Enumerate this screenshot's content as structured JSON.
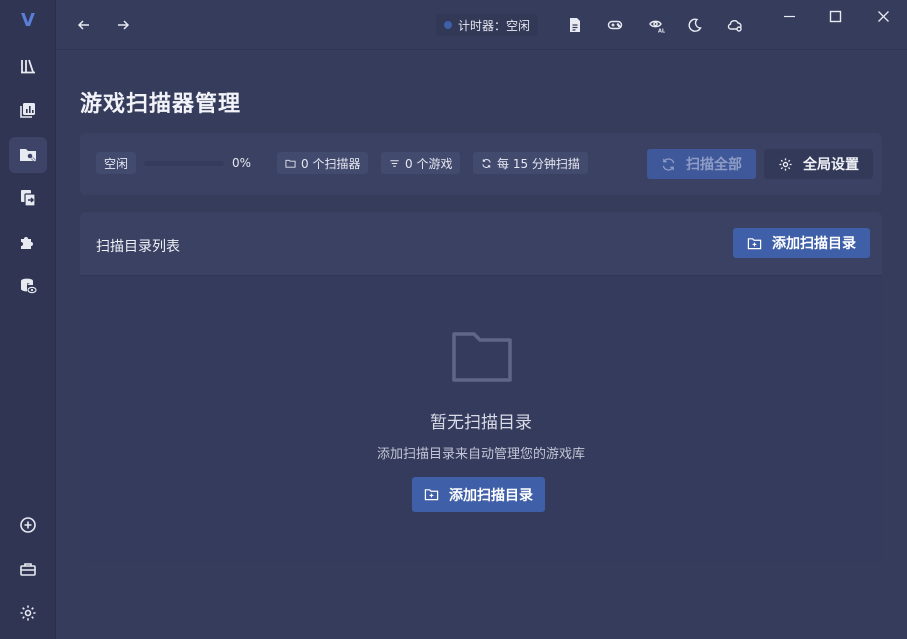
{
  "app": {
    "logo": "V"
  },
  "sidebar": {
    "items": [
      {
        "icon": "library-icon"
      },
      {
        "icon": "stats-icon"
      },
      {
        "icon": "folder-search-icon",
        "active": true
      },
      {
        "icon": "import-icon"
      },
      {
        "icon": "plugin-icon"
      },
      {
        "icon": "database-view-icon"
      }
    ],
    "bottom": [
      {
        "icon": "add-circle-icon"
      },
      {
        "icon": "toolbox-icon"
      },
      {
        "icon": "settings-icon"
      }
    ]
  },
  "titlebar": {
    "timer_label": "计时器：空闲",
    "actions": [
      "document-icon",
      "gamepad-icon",
      "eye-all-icon",
      "moon-icon",
      "cloud-icon"
    ]
  },
  "page": {
    "title": "游戏扫描器管理"
  },
  "toolbar": {
    "status": "空闲",
    "progress_percent": 0,
    "progress_label": "0%",
    "scanners": "0 个扫描器",
    "games": "0 个游戏",
    "interval": "每 15 分钟扫描",
    "scan_all": "扫描全部",
    "global_settings": "全局设置"
  },
  "panel": {
    "title": "扫描目录列表",
    "add_button": "添加扫描目录",
    "empty_title": "暂无扫描目录",
    "empty_desc": "添加扫描目录来自动管理您的游戏库",
    "empty_button": "添加扫描目录"
  },
  "colors": {
    "accent": "#3f5fa8",
    "background": "#353c5c",
    "sidebar": "#2f3553"
  }
}
